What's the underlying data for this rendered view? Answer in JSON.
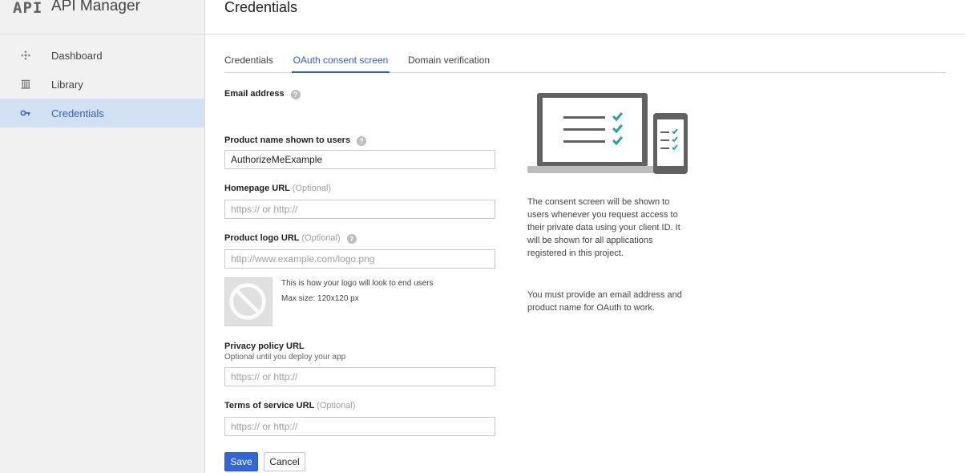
{
  "brand": {
    "logo": "API",
    "title": "API Manager"
  },
  "sidebar": {
    "items": [
      {
        "label": "Dashboard",
        "icon": "dashboard-icon"
      },
      {
        "label": "Library",
        "icon": "library-icon"
      },
      {
        "label": "Credentials",
        "icon": "key-icon",
        "active": true
      }
    ]
  },
  "header": {
    "title": "Credentials"
  },
  "tabs": [
    {
      "label": "Credentials"
    },
    {
      "label": "OAuth consent screen",
      "active": true
    },
    {
      "label": "Domain verification"
    }
  ],
  "form": {
    "email": {
      "label": "Email address"
    },
    "product_name": {
      "label": "Product name shown to users",
      "value": "AuthorizeMeExample"
    },
    "homepage": {
      "label": "Homepage URL",
      "optional": "(Optional)",
      "placeholder": "https:// or http://"
    },
    "logo_url": {
      "label": "Product logo URL",
      "optional": "(Optional)",
      "placeholder": "http://www.example.com/logo.png"
    },
    "logo_preview": {
      "note": "This is how your logo will look to end users",
      "max_size": "Max size: 120x120 px"
    },
    "privacy": {
      "label": "Privacy policy URL",
      "sub": "Optional until you deploy your app",
      "placeholder": "https:// or http://"
    },
    "terms": {
      "label": "Terms of service URL",
      "optional": "(Optional)",
      "placeholder": "https:// or http://"
    },
    "save_label": "Save",
    "cancel_label": "Cancel"
  },
  "info": {
    "paragraph1": "The consent screen will be shown to users whenever you request access to their private data using your client ID. It will be shown for all applications registered in this project.",
    "paragraph2": "You must provide an email address and product name for OAuth to work."
  },
  "colors": {
    "accent": "#2d62c6",
    "save_button": "#3367d6",
    "check_teal": "#26a69a",
    "active_nav_bg": "#d2e0f4"
  }
}
